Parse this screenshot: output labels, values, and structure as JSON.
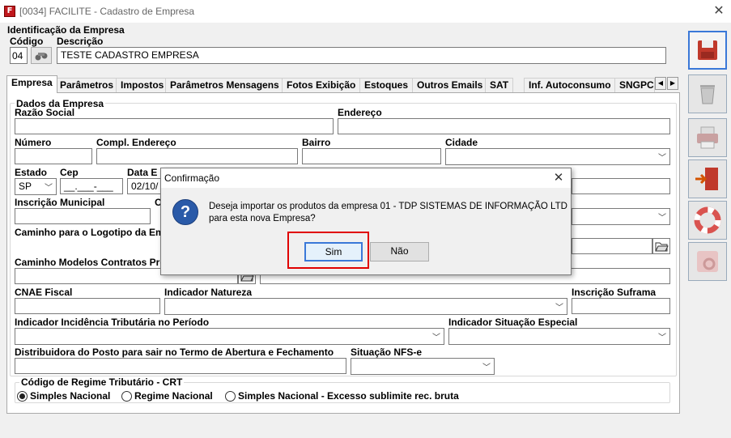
{
  "window": {
    "title": "[0034] FACILITE - Cadastro de Empresa",
    "app_icon": "F"
  },
  "identificacao": {
    "group_label": "Identificação da Empresa",
    "codigo_label": "Código",
    "codigo_value": "04",
    "descricao_label": "Descrição",
    "descricao_value": "TESTE CADASTRO EMPRESA"
  },
  "tabs": [
    "Empresa",
    "Parâmetros",
    "Impostos",
    "Parâmetros Mensagens",
    "Fotos Exibição",
    "Estoques",
    "Outros Emails",
    "SAT",
    "Inf. Autoconsumo",
    "SNGPC"
  ],
  "form": {
    "dados_label": "Dados da Empresa",
    "razao_social_label": "Razão Social",
    "endereco_label": "Endereço",
    "numero_label": "Número",
    "compl_label": "Compl. Endereço",
    "bairro_label": "Bairro",
    "cidade_label": "Cidade",
    "estado_label": "Estado",
    "estado_value": "SP",
    "cep_label": "Cep",
    "cep_value": "__.___-___",
    "data_label": "Data E",
    "data_value": "02/10/",
    "inscricao_municipal_label": "Inscrição Municipal",
    "c_label": "C",
    "logotipo_label": "Caminho para o Logotipo da Em",
    "modelos_label": "Caminho Modelos Contratos Pre",
    "cnae_label": "CNAE Fiscal",
    "natureza_label": "Indicador Natureza",
    "suframa_label": "Inscrição Suframa",
    "incidencia_label": "Indicador Incidência Tributária no Período",
    "situacao_especial_label": "Indicador Situação Especial",
    "distribuidora_label": "Distribuidora do Posto para sair no Termo de Abertura e Fechamento",
    "nfse_label": "Situação NFS-e",
    "crt_label": "Código de Regime Tributário - CRT",
    "crt_options": [
      "Simples Nacional",
      "Regime Nacional",
      "Simples Nacional - Excesso sublimite rec. bruta"
    ],
    "crt_selected": "Simples Nacional"
  },
  "sidebar": [
    "save-icon",
    "trash-icon",
    "print-icon",
    "exit-door-icon",
    "help-lifebuoy-icon",
    "settings-gear-icon"
  ],
  "dialog": {
    "title": "Confirmação",
    "message_line1": "Deseja importar os produtos da empresa 01 - TDP SISTEMAS DE INFORMAÇÃO LTD",
    "message_line2": "para esta nova Empresa?",
    "yes_label": "Sim",
    "no_label": "Não",
    "highlight_color": "#e00000"
  }
}
